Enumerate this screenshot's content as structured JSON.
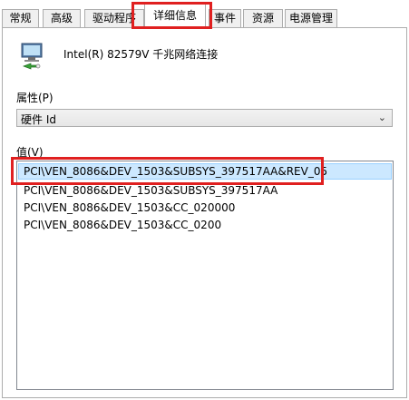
{
  "tabs": [
    {
      "label": "常规"
    },
    {
      "label": "高级"
    },
    {
      "label": "驱动程序"
    },
    {
      "label": "详细信息"
    },
    {
      "label": "事件"
    },
    {
      "label": "资源"
    },
    {
      "label": "电源管理"
    }
  ],
  "device": {
    "name": "Intel(R) 82579V 千兆网络连接",
    "icon": "network-adapter-icon"
  },
  "property": {
    "label": "属性(P)",
    "selected": "硬件 Id"
  },
  "value": {
    "label": "值(V)",
    "items": [
      "PCI\\VEN_8086&DEV_1503&SUBSYS_397517AA&REV_05",
      "PCI\\VEN_8086&DEV_1503&SUBSYS_397517AA",
      "PCI\\VEN_8086&DEV_1503&CC_020000",
      "PCI\\VEN_8086&DEV_1503&CC_0200"
    ]
  },
  "colors": {
    "highlight_box": "#e02020",
    "selected_row": "#cce8ff",
    "tab_border": "#adadad"
  }
}
